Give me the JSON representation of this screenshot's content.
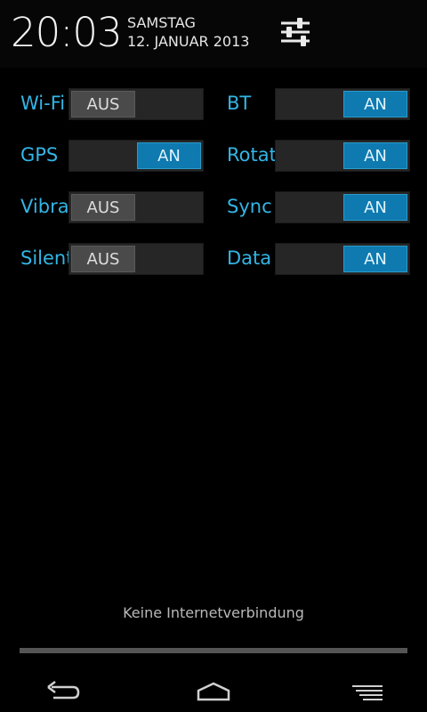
{
  "header": {
    "time": "20:03",
    "day": "SAMSTAG",
    "date": "12. JANUAR 2013",
    "settings_icon": "settings-sliders-icon"
  },
  "toggles": [
    {
      "label": "Wi-Fi",
      "state": "AUS"
    },
    {
      "label": "BT",
      "state": "AN"
    },
    {
      "label": "GPS",
      "state": "AN"
    },
    {
      "label": "Rotate",
      "state": "AN"
    },
    {
      "label": "Vibrate",
      "state": "AUS"
    },
    {
      "label": "Sync",
      "state": "AN"
    },
    {
      "label": "Silent",
      "state": "AUS"
    },
    {
      "label": "Data",
      "state": "AN"
    }
  ],
  "status": {
    "connection": "Keine Internetverbindung"
  },
  "navbar": {
    "back_icon": "back-arrow-icon",
    "home_icon": "home-icon",
    "recents_icon": "recent-apps-icon"
  },
  "colors": {
    "accent": "#33b5e5",
    "switch_on": "#0e7ab0",
    "switch_off": "#4a4a4a"
  }
}
